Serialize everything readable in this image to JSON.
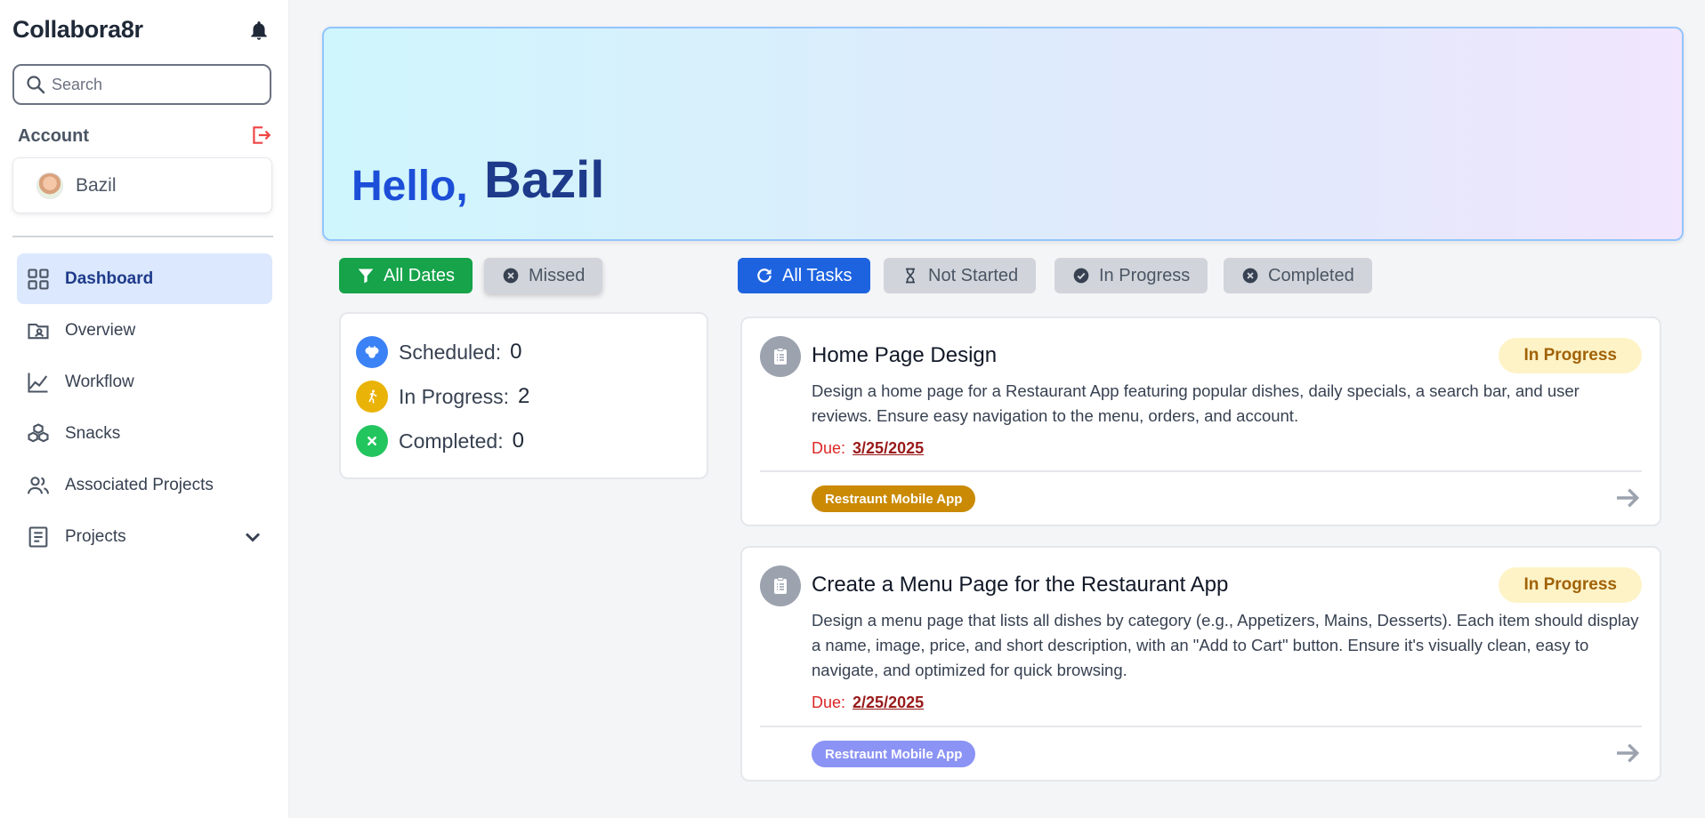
{
  "app": {
    "title": "Collabora8r"
  },
  "search": {
    "placeholder": "Search",
    "value": ""
  },
  "account": {
    "label": "Account",
    "user_name": "Bazil"
  },
  "sidebar": {
    "items": [
      {
        "label": "Dashboard",
        "icon": "grid-icon",
        "active": true
      },
      {
        "label": "Overview",
        "icon": "folder-user-icon"
      },
      {
        "label": "Workflow",
        "icon": "line-chart-icon"
      },
      {
        "label": "Snacks",
        "icon": "cubes-icon"
      },
      {
        "label": "Associated Projects",
        "icon": "users-icon"
      },
      {
        "label": "Projects",
        "icon": "document-icon",
        "has_dropdown": true
      }
    ]
  },
  "hero": {
    "greeting": "Hello,",
    "name": "Bazil"
  },
  "date_filters": [
    {
      "label": "All Dates",
      "icon": "filter-icon",
      "active": true
    },
    {
      "label": "Missed",
      "icon": "x-circle-icon",
      "active": false
    }
  ],
  "task_filters": [
    {
      "label": "All Tasks",
      "icon": "refresh-icon",
      "active": true
    },
    {
      "label": "Not Started",
      "icon": "hourglass-icon",
      "active": false
    },
    {
      "label": "In Progress",
      "icon": "check-circle-icon",
      "active": false
    },
    {
      "label": "Completed",
      "icon": "x-circle-icon",
      "active": false
    }
  ],
  "stats": [
    {
      "label": "Scheduled:",
      "value": "0",
      "color": "#3b82f6",
      "icon": "clock-icon"
    },
    {
      "label": "In Progress:",
      "value": "2",
      "color": "#eab308",
      "icon": "running-icon"
    },
    {
      "label": "Completed:",
      "value": "0",
      "color": "#22c55e",
      "icon": "x-icon"
    }
  ],
  "tasks": [
    {
      "title": "Home Page Design",
      "status": "In Progress",
      "description": "Design a home page for a Restaurant App featuring popular dishes, daily specials, a search bar, and user reviews. Ensure easy navigation to the menu, orders, and account.",
      "due_label": "Due:",
      "due_date": "3/25/2025",
      "project": "Restraunt Mobile App",
      "project_color": "#ca8a04"
    },
    {
      "title": "Create a Menu Page for the Restaurant App",
      "status": "In Progress",
      "description": "Design a menu page that lists all dishes by category (e.g., Appetizers, Mains, Desserts). Each item should display a name, image, price, and short description, with an \"Add to Cart\" button. Ensure it's visually clean, easy to navigate, and optimized for quick browsing.",
      "due_label": "Due:",
      "due_date": "2/25/2025",
      "project": "Restraunt Mobile App",
      "project_color": "#8b93f4"
    }
  ]
}
